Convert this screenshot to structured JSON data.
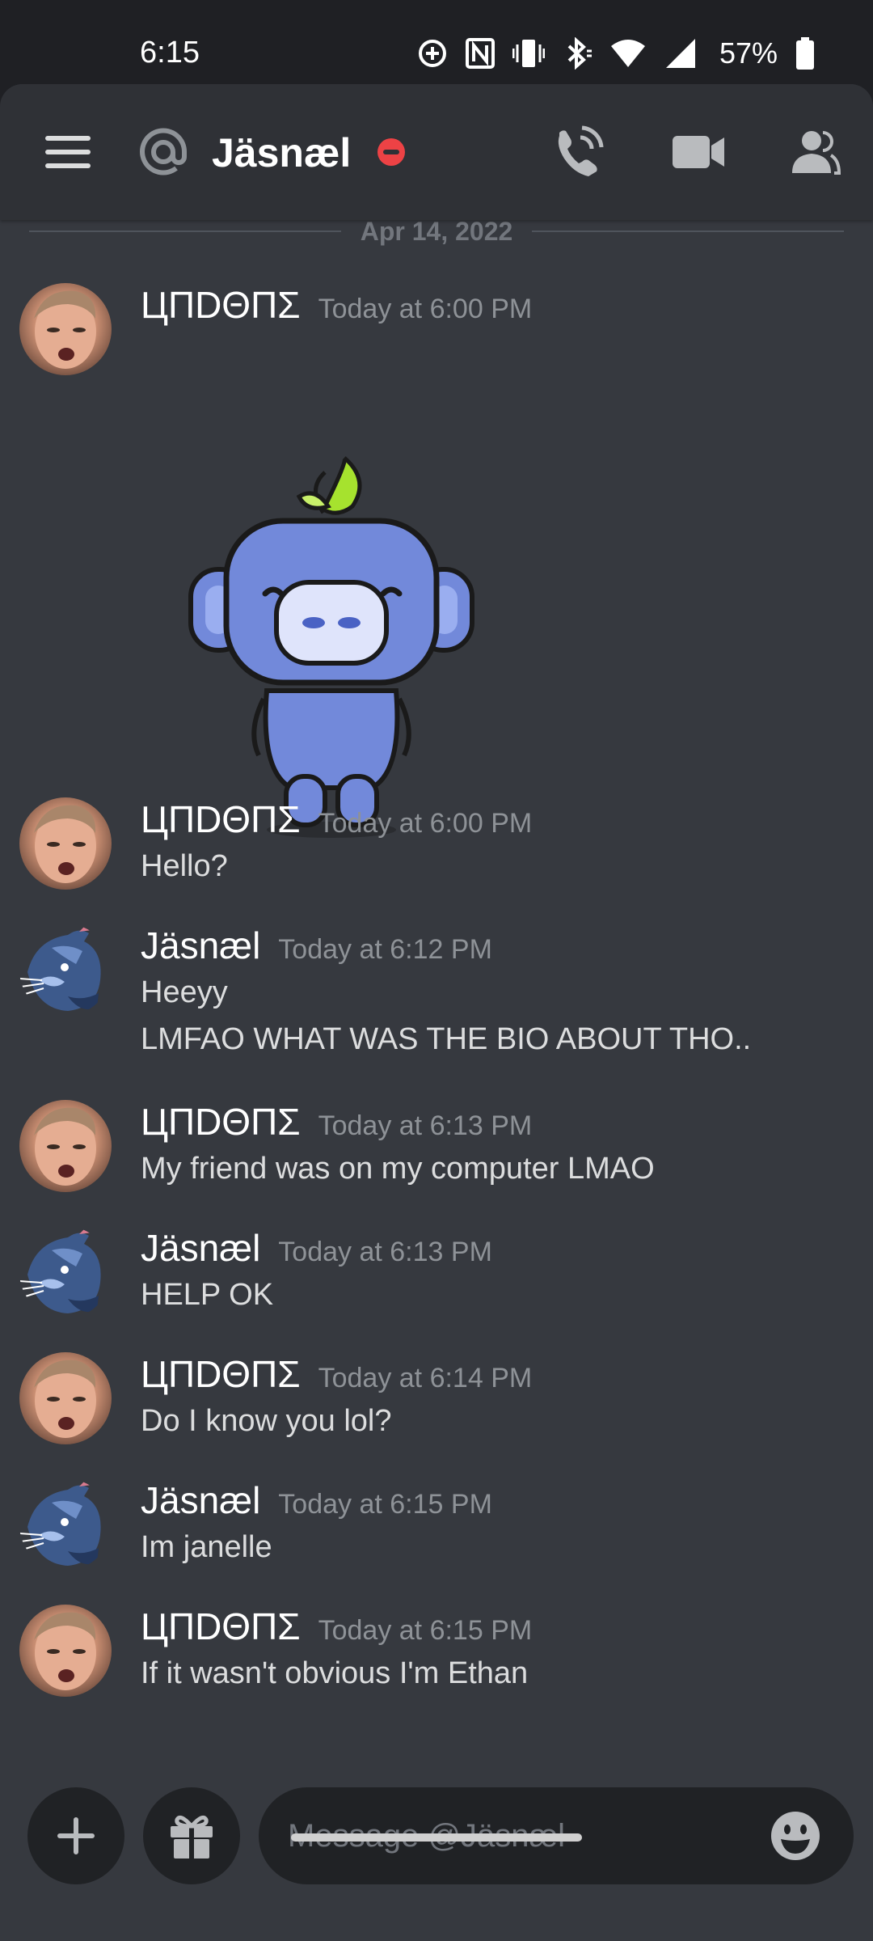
{
  "status": {
    "time": "6:15",
    "battery": "57%"
  },
  "header": {
    "title": "Jäsnæl"
  },
  "date_divider": "Apr 14, 2022",
  "messages": [
    {
      "username": "ЦПDΘПΣ",
      "time": "Today at 6:00 PM",
      "lines": []
    },
    {
      "username": "ЦПDΘПΣ",
      "time": "Today at 6:00 PM",
      "lines": [
        "Hello?"
      ]
    },
    {
      "username": "Jäsnæl",
      "time": "Today at 6:12 PM",
      "lines": [
        "Heeyy",
        "LMFAO WHAT WAS THE BIO ABOUT THO.."
      ]
    },
    {
      "username": "ЦПDΘПΣ",
      "time": "Today at 6:13 PM",
      "lines": [
        "My friend was on my computer LMAO"
      ]
    },
    {
      "username": "Jäsnæl",
      "time": "Today at 6:13 PM",
      "lines": [
        "HELP OK"
      ]
    },
    {
      "username": "ЦПDΘПΣ",
      "time": "Today at 6:14 PM",
      "lines": [
        "Do I know you lol?"
      ]
    },
    {
      "username": "Jäsnæl",
      "time": "Today at 6:15 PM",
      "lines": [
        "Im janelle"
      ]
    },
    {
      "username": "ЦПDΘПΣ",
      "time": "Today at 6:15 PM",
      "lines": [
        "If it wasn't obvious I'm Ethan"
      ]
    }
  ],
  "composer": {
    "placeholder": "Message @Jäsnæl"
  },
  "colors": {
    "background": "#36393f",
    "header": "#2f3136",
    "input": "#202225",
    "dnd": "#ed4245",
    "sticker_body": "#7289da",
    "leaf": "#a6e22e"
  }
}
